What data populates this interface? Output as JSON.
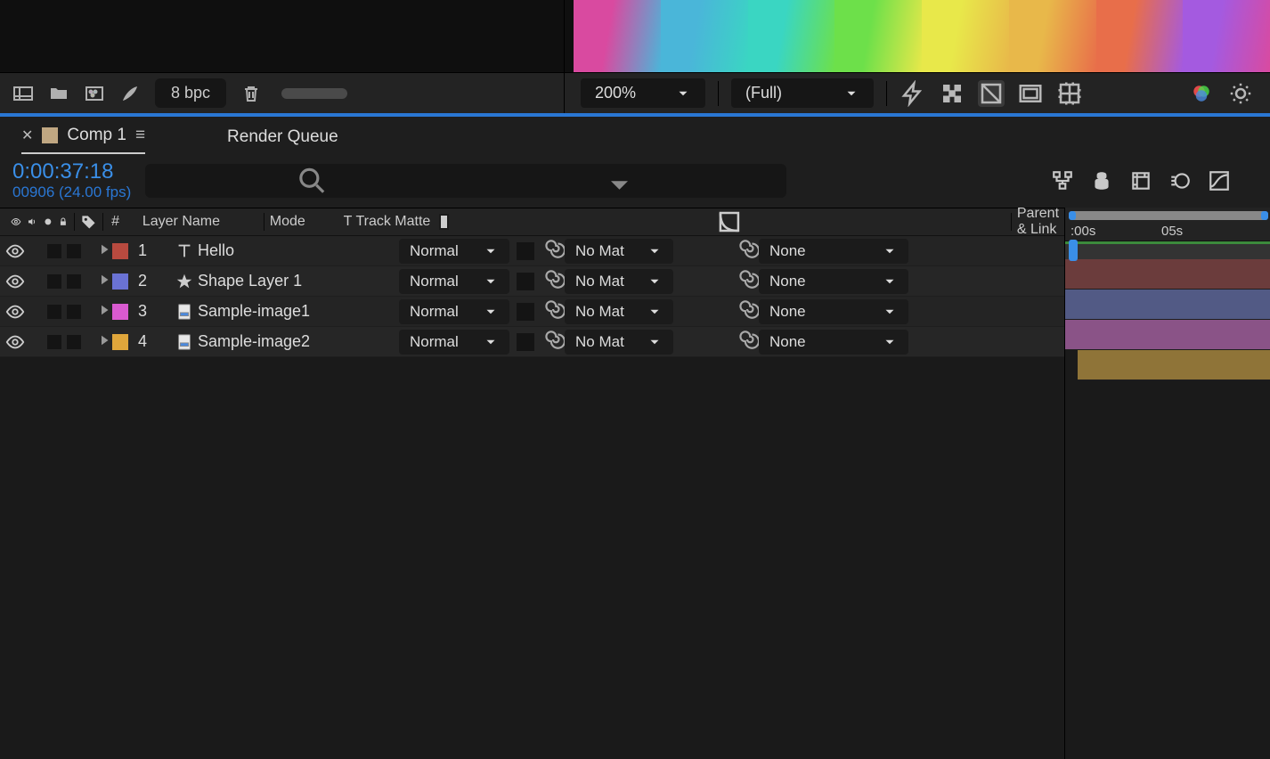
{
  "project_toolbar": {
    "bpc": "8 bpc"
  },
  "viewer": {
    "zoom": "200%",
    "resolution": "(Full)"
  },
  "tabs": {
    "active": "Comp 1",
    "inactive": "Render Queue"
  },
  "timecode": {
    "tc": "0:00:37:18",
    "frame": "00906 (24.00 fps)"
  },
  "columns": {
    "num": "#",
    "name": "Layer Name",
    "mode": "Mode",
    "t": "T",
    "tm": "Track Matte",
    "pl": "Parent & Link"
  },
  "ruler": {
    "t0": ":00s",
    "t1": "05s"
  },
  "layers": [
    {
      "num": "1",
      "name": "Hello",
      "type": "text",
      "color": "#b84a3f",
      "mode": "Normal",
      "tm": "No Mat",
      "pl": "None",
      "bar": "#6b3c3c"
    },
    {
      "num": "2",
      "name": "Shape Layer 1",
      "type": "shape",
      "color": "#6a72d4",
      "mode": "Normal",
      "tm": "No Mat",
      "pl": "None",
      "bar": "#525a85"
    },
    {
      "num": "3",
      "name": "Sample-image1",
      "type": "image",
      "color": "#d95ad0",
      "mode": "Normal",
      "tm": "No Mat",
      "pl": "None",
      "bar": "#8a5387"
    },
    {
      "num": "4",
      "name": "Sample-image2",
      "type": "image",
      "color": "#e0a63b",
      "mode": "Normal",
      "tm": "No Mat",
      "pl": "None",
      "bar": "#8f7438"
    }
  ],
  "rainbow": [
    "#d94aa0",
    "#4ab6d9",
    "#3ad6c2",
    "#6de04a",
    "#e8e84a",
    "#e8b84a",
    "#e86e4a",
    "#a45ae0"
  ]
}
